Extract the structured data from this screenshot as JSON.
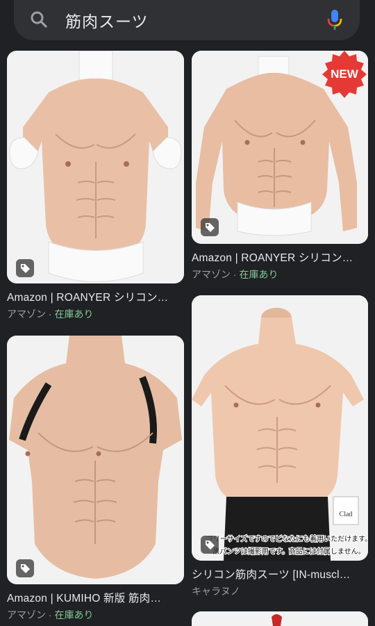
{
  "search": {
    "query": "筋肉スーツ",
    "search_icon": "search-icon",
    "mic_icon": "microphone-icon"
  },
  "results": [
    {
      "title": "Amazon | ROANYER シリコン…",
      "source": "アマゾン",
      "separator": " · ",
      "availability": "在庫あり",
      "tag_icon": "tag-icon"
    },
    {
      "title": "Amazon | ROANYER シリコン…",
      "source": "アマゾン",
      "separator": " · ",
      "availability": "在庫あり",
      "badge": "NEW",
      "tag_icon": "tag-icon"
    },
    {
      "title": "Amazon | KUMIHO 新版 筋肉…",
      "source": "アマゾン",
      "separator": " · ",
      "availability": "在庫あり",
      "tag_icon": "tag-icon"
    },
    {
      "title": "シリコン筋肉スーツ [IN-muscl…",
      "source": "キャラヌノ",
      "overlay_line1": "フリーサイズですのでどなたにも着用いただけます。",
      "overlay_line2": "黒パンツは撮影用です。商品には付属しません。",
      "logo_text": "Clad",
      "tag_icon": "tag-icon"
    }
  ],
  "colors": {
    "background": "#202124",
    "search_bg": "#303134",
    "in_stock": "#81c995",
    "secondary_text": "#9aa0a6",
    "skin": "#e8bfa6"
  }
}
